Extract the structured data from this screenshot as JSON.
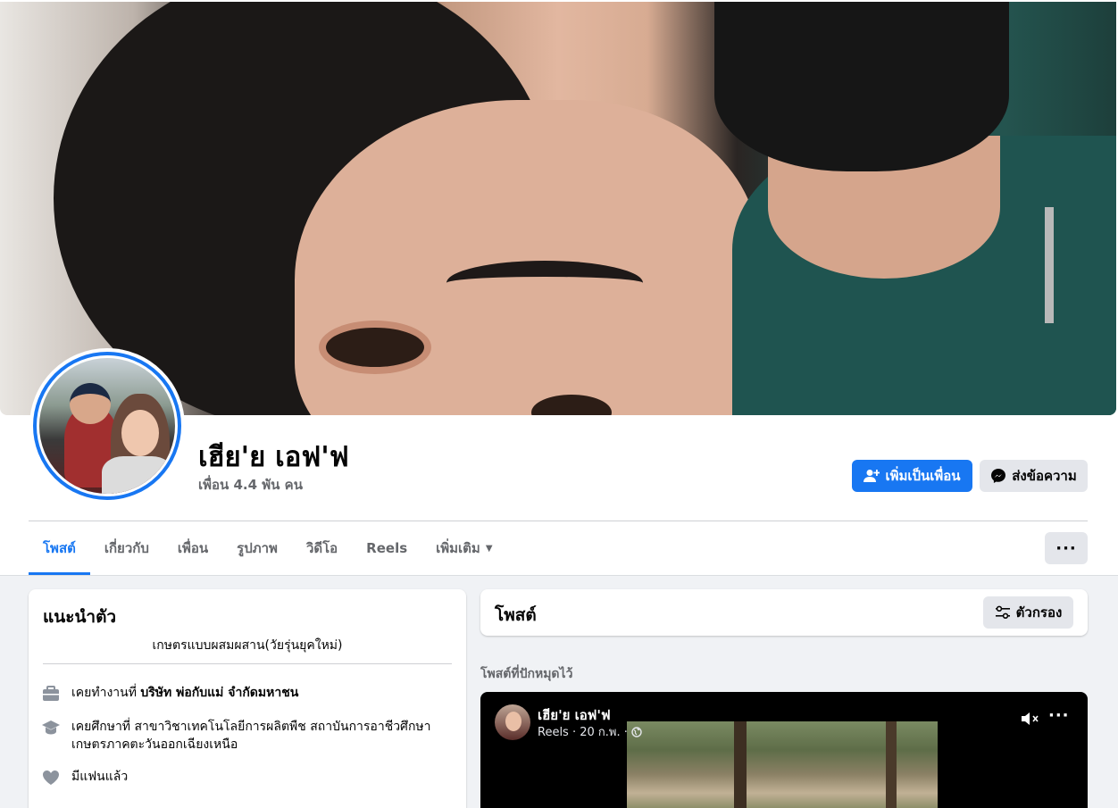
{
  "profile": {
    "name": "เฮีย'ย เอฟ'ฟ",
    "friends": "เพื่อน 4.4 พัน คน"
  },
  "actions": {
    "add_friend": "เพิ่มเป็นเพื่อน",
    "message": "ส่งข้อความ"
  },
  "tabs": [
    {
      "label": "โพสต์",
      "active": true
    },
    {
      "label": "เกี่ยวกับ"
    },
    {
      "label": "เพื่อน"
    },
    {
      "label": "รูปภาพ"
    },
    {
      "label": "วิดีโอ"
    },
    {
      "label": "Reels"
    },
    {
      "label": "เพิ่มเติม"
    }
  ],
  "intro": {
    "title": "แนะนำตัว",
    "bio": "เกษตรแบบผสมผสาน(วัยรุ่นยุคใหม่)",
    "work_prefix": "เคยทำงานที่ ",
    "work_place": "บริษัท พ่อกับแม่ จำกัดมหาชน",
    "edu_line1": "เคยศึกษาที่ สาขาวิชาเทคโนโลยีการผลิตพืช สถาบันการอาชีวศึกษา",
    "edu_line2": "เกษตรภาคตะวันออกเฉียงเหนือ",
    "relationship": "มีแฟนแล้ว"
  },
  "posts": {
    "title": "โพสต์",
    "filter": "ตัวกรอง",
    "pinned_label": "โพสต์ที่ปักหมุดไว้"
  },
  "reel": {
    "author": "เฮีย'ย เอฟ'ฟ",
    "meta": "Reels · 20 ก.พ. ·"
  },
  "colors": {
    "accent": "#1877f2",
    "page_bg": "#f0f2f5",
    "secondary_button": "#e4e6eb"
  }
}
